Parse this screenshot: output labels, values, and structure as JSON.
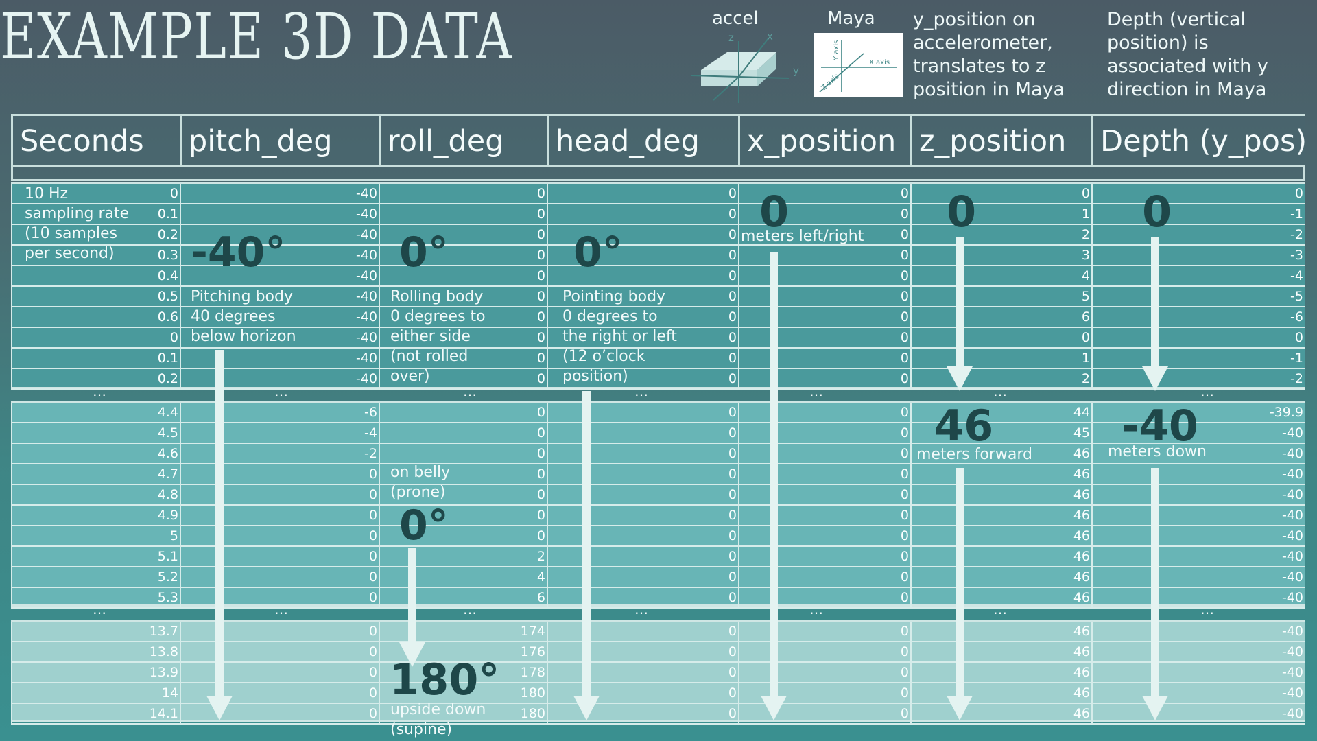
{
  "title": "EXAMPLE 3D DATA",
  "legend": {
    "accel_label": "accel",
    "maya_label": "Maya",
    "accel_axes": [
      "z",
      "x",
      "y"
    ],
    "maya_axes": [
      "Y axis",
      "X axis",
      "Z axis"
    ],
    "note1": [
      "y_position on",
      "accelerometer,",
      "translates to z",
      "position in Maya"
    ],
    "note2": [
      "Depth (vertical",
      "position) is",
      "associated with y",
      "direction in Maya"
    ]
  },
  "headers": [
    "Seconds",
    "pitch_deg",
    "roll_deg",
    "head_deg",
    "x_position",
    "z_position",
    "Depth (y_pos)"
  ],
  "table": {
    "band1": [
      [
        "0",
        "-40",
        "0",
        "0",
        "0",
        "0",
        "0"
      ],
      [
        "0.1",
        "-40",
        "0",
        "0",
        "0",
        "1",
        "-1"
      ],
      [
        "0.2",
        "-40",
        "0",
        "0",
        "0",
        "2",
        "-2"
      ],
      [
        "0.3",
        "-40",
        "0",
        "0",
        "0",
        "3",
        "-3"
      ],
      [
        "0.4",
        "-40",
        "0",
        "0",
        "0",
        "4",
        "-4"
      ],
      [
        "0.5",
        "-40",
        "0",
        "0",
        "0",
        "5",
        "-5"
      ],
      [
        "0.6",
        "-40",
        "0",
        "0",
        "0",
        "6",
        "-6"
      ],
      [
        "0",
        "-40",
        "0",
        "0",
        "0",
        "0",
        "0"
      ],
      [
        "0.1",
        "-40",
        "0",
        "0",
        "0",
        "1",
        "-1"
      ],
      [
        "0.2",
        "-40",
        "0",
        "0",
        "0",
        "2",
        "-2"
      ]
    ],
    "band2": [
      [
        "4.4",
        "-6",
        "0",
        "0",
        "0",
        "44",
        "-39.9"
      ],
      [
        "4.5",
        "-4",
        "0",
        "0",
        "0",
        "45",
        "-40"
      ],
      [
        "4.6",
        "-2",
        "0",
        "0",
        "0",
        "46",
        "-40"
      ],
      [
        "4.7",
        "0",
        "0",
        "0",
        "0",
        "46",
        "-40"
      ],
      [
        "4.8",
        "0",
        "0",
        "0",
        "0",
        "46",
        "-40"
      ],
      [
        "4.9",
        "0",
        "0",
        "0",
        "0",
        "46",
        "-40"
      ],
      [
        "5",
        "0",
        "0",
        "0",
        "0",
        "46",
        "-40"
      ],
      [
        "5.1",
        "0",
        "2",
        "0",
        "0",
        "46",
        "-40"
      ],
      [
        "5.2",
        "0",
        "4",
        "0",
        "0",
        "46",
        "-40"
      ],
      [
        "5.3",
        "0",
        "6",
        "0",
        "0",
        "46",
        "-40"
      ]
    ],
    "band3": [
      [
        "13.7",
        "0",
        "174",
        "0",
        "0",
        "46",
        "-40"
      ],
      [
        "13.8",
        "0",
        "176",
        "0",
        "0",
        "46",
        "-40"
      ],
      [
        "13.9",
        "0",
        "178",
        "0",
        "0",
        "46",
        "-40"
      ],
      [
        "14",
        "0",
        "180",
        "0",
        "0",
        "46",
        "-40"
      ],
      [
        "14.1",
        "0",
        "180",
        "0",
        "0",
        "46",
        "-40"
      ]
    ],
    "ellipsis": "…"
  },
  "annotations": {
    "sampling": [
      "10 Hz",
      "sampling rate",
      "(10 samples",
      "per second)"
    ],
    "pitch_big": "-40°",
    "pitch_text": [
      "Pitching body",
      "40 degrees",
      "below horizon"
    ],
    "roll_big": "0°",
    "roll_text": [
      "Rolling body",
      "0 degrees to",
      "either side",
      "(not rolled",
      "over)"
    ],
    "head_big": "0°",
    "head_text": [
      "Pointing body",
      "0 degrees to",
      "the right or left",
      "(12 o’clock",
      "position)"
    ],
    "x_big": "0",
    "x_text": "meters left/right",
    "z_big_top": "0",
    "depth_big_top": "0",
    "z_big_mid": "46",
    "z_text_mid": "meters forward",
    "depth_big_mid": "-40",
    "depth_text_mid": "meters down",
    "roll_text_prone": [
      "on belly",
      "(prone)"
    ],
    "roll_big_prone": "0°",
    "roll_big_supine": "180°",
    "roll_text_supine": [
      "upside down",
      "(supine)"
    ]
  },
  "colors": {
    "band1": "#4a9a9c",
    "band2": "#68b5b6",
    "band3": "#9fd0ce",
    "big_text": "#1e4749",
    "arrow": "#e4f3f1"
  }
}
